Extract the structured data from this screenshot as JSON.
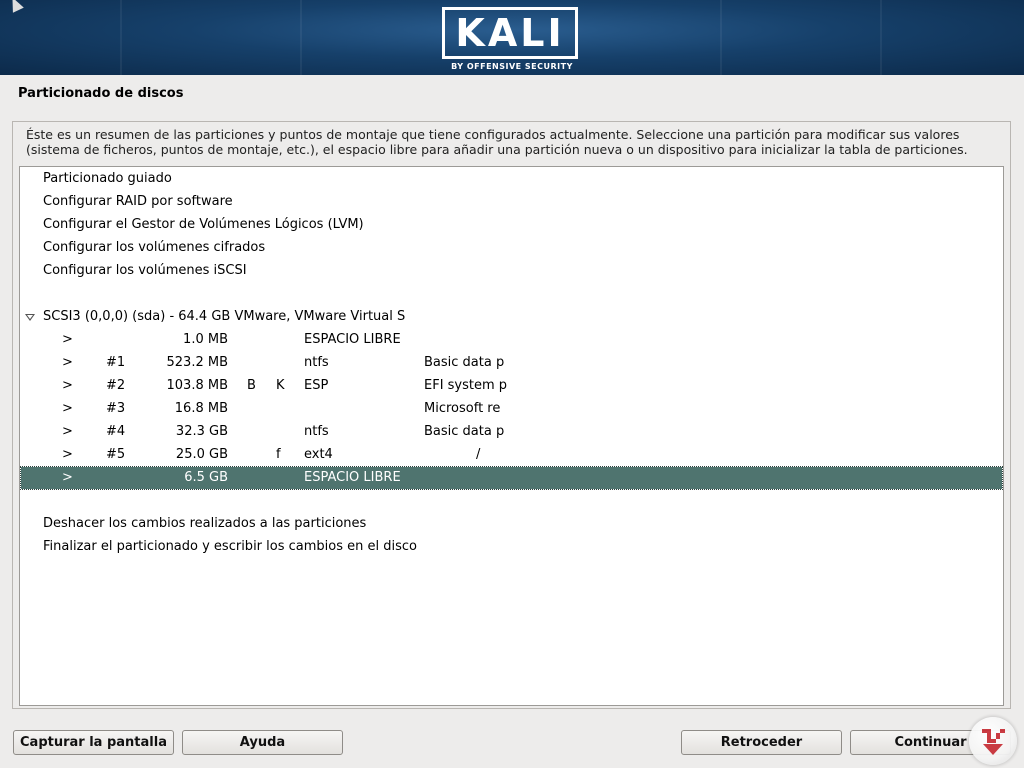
{
  "banner": {
    "logo_text": "KALI",
    "logo_subtitle": "BY OFFENSIVE SECURITY"
  },
  "page_title": "Particionado de discos",
  "intro_text": "Éste es un resumen de las particiones y puntos de montaje que tiene configurados actualmente. Seleccione una partición para modificar sus valores (sistema de ficheros, puntos de montaje, etc.), el espacio libre para añadir una partición nueva o un dispositivo para inicializar la tabla de particiones.",
  "menu_items": [
    "Particionado guiado",
    "Configurar RAID por software",
    "Configurar el Gestor de Volúmenes Lógicos (LVM)",
    "Configurar los volúmenes cifrados",
    "Configurar los volúmenes iSCSI"
  ],
  "disk": {
    "label": "SCSI3 (0,0,0) (sda) - 64.4 GB VMware, VMware Virtual S",
    "expanded_icon": "triangle-down-icon"
  },
  "partitions": [
    {
      "arrow": ">",
      "num": "",
      "size": "1.0 MB",
      "flag1": "",
      "flag2": "",
      "fs": "ESPACIO LIBRE",
      "name": "",
      "selected": false
    },
    {
      "arrow": ">",
      "num": "#1",
      "size": "523.2 MB",
      "flag1": "",
      "flag2": "",
      "fs": "ntfs",
      "name": "Basic data p",
      "selected": false
    },
    {
      "arrow": ">",
      "num": "#2",
      "size": "103.8 MB",
      "flag1": "B",
      "flag2": "K",
      "fs": "ESP",
      "name": "EFI system p",
      "selected": false
    },
    {
      "arrow": ">",
      "num": "#3",
      "size": "16.8 MB",
      "flag1": "",
      "flag2": "",
      "fs": "",
      "name": "Microsoft re",
      "selected": false
    },
    {
      "arrow": ">",
      "num": "#4",
      "size": "32.3 GB",
      "flag1": "",
      "flag2": "",
      "fs": "ntfs",
      "name": "Basic data p",
      "selected": false
    },
    {
      "arrow": ">",
      "num": "#5",
      "size": "25.0 GB",
      "flag1": "",
      "flag2": "f",
      "fs": "ext4",
      "name": "/",
      "selected": false
    },
    {
      "arrow": ">",
      "num": "",
      "size": "6.5 GB",
      "flag1": "",
      "flag2": "",
      "fs": "ESPACIO LIBRE",
      "name": "",
      "selected": true
    }
  ],
  "actions": [
    "Deshacer los cambios realizados a las particiones",
    "Finalizar el particionado y escribir los cambios en el disco"
  ],
  "buttons": {
    "screenshot": "Capturar la pantalla",
    "help": "Ayuda",
    "back": "Retroceder",
    "continue": "Continuar"
  },
  "colors": {
    "selection": "#4f746f",
    "banner": "#16406a",
    "background": "#edeceb"
  }
}
